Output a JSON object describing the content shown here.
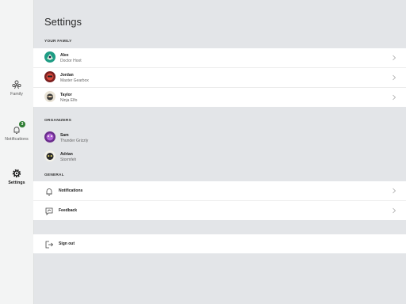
{
  "sidebar": {
    "items": [
      {
        "label": "Family",
        "icon": "family-icon"
      },
      {
        "label": "Notifications",
        "icon": "bell-icon",
        "badge": "3"
      },
      {
        "label": "Settings",
        "icon": "gear-icon",
        "active": true
      }
    ]
  },
  "page": {
    "title": "Settings"
  },
  "family": {
    "heading": "YOUR FAMILY",
    "members": [
      {
        "name": "Alex",
        "gamertag": "Doctor Hoot"
      },
      {
        "name": "Jordan",
        "gamertag": "Master Gearbox"
      },
      {
        "name": "Taylor",
        "gamertag": "Ninja Elfo"
      }
    ]
  },
  "organizers": {
    "heading": "ORGANIZERS",
    "members": [
      {
        "name": "Sam",
        "gamertag": "Thunder Grizzly"
      },
      {
        "name": "Adrian",
        "gamertag": "Stormfeh"
      }
    ]
  },
  "general": {
    "heading": "GENERAL",
    "items": [
      {
        "label": "Notifications",
        "icon": "bell-icon"
      },
      {
        "label": "Feedback",
        "icon": "feedback-icon"
      }
    ]
  },
  "signout": {
    "label": "Sign out",
    "icon": "sign-out-icon"
  },
  "colors": {
    "badge": "#2e7d32",
    "background": "#e3e5e8",
    "sidebar": "#f3f4f4"
  }
}
